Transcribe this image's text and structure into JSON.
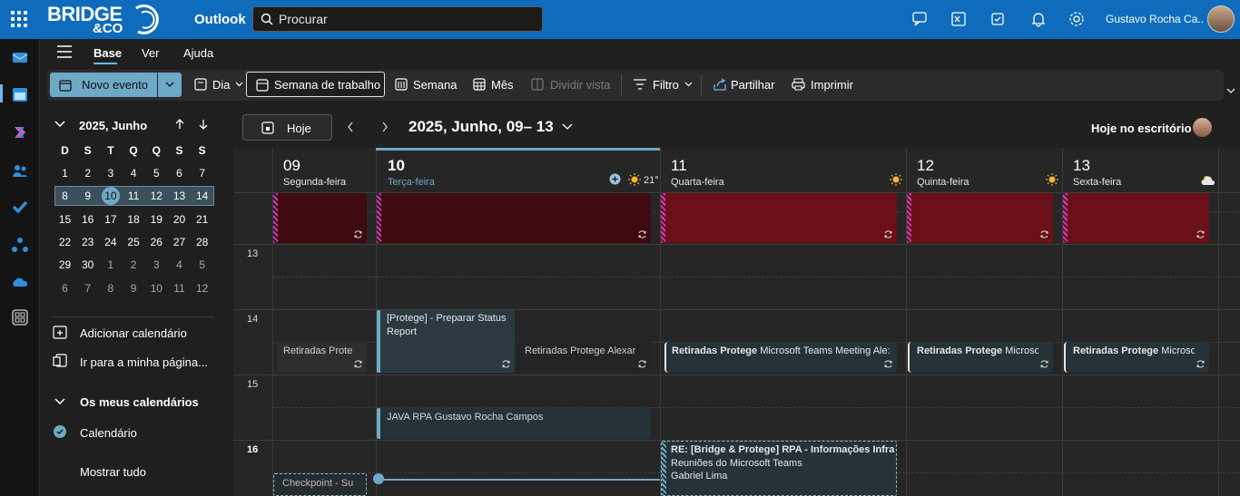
{
  "app": {
    "brand_line1": "BRIDGE",
    "brand_line2": "&CO",
    "name": "Outlook"
  },
  "search": {
    "placeholder": "Procurar"
  },
  "user": {
    "name": "Gustavo Rocha Ca..."
  },
  "tabs": [
    {
      "label": "Base"
    },
    {
      "label": "Ver"
    },
    {
      "label": "Ajuda"
    }
  ],
  "ribbon": {
    "novo_evento": "Novo evento",
    "dia": "Dia",
    "semana_trabalho": "Semana de trabalho",
    "semana": "Semana",
    "mes": "Mês",
    "dividir": "Dividir vista",
    "filtro": "Filtro",
    "partilhar": "Partilhar",
    "imprimir": "Imprimir"
  },
  "minical": {
    "title": "2025, Junho",
    "weekdays": [
      "D",
      "S",
      "T",
      "Q",
      "Q",
      "S",
      "S"
    ],
    "weeks": [
      [
        "1",
        "2",
        "3",
        "4",
        "5",
        "6",
        "7"
      ],
      [
        "8",
        "9",
        "10",
        "11",
        "12",
        "13",
        "14"
      ],
      [
        "15",
        "16",
        "17",
        "18",
        "19",
        "20",
        "21"
      ],
      [
        "22",
        "23",
        "24",
        "25",
        "26",
        "27",
        "28"
      ],
      [
        "29",
        "30",
        "1",
        "2",
        "3",
        "4",
        "5"
      ],
      [
        "6",
        "7",
        "8",
        "9",
        "10",
        "11",
        "12"
      ]
    ]
  },
  "sidebar": {
    "add_calendar": "Adicionar calendário",
    "my_page": "Ir para a minha página...",
    "my_calendars": "Os meus calendários",
    "calendar": "Calendário",
    "show_all": "Mostrar tudo"
  },
  "calendar": {
    "today_btn": "Hoje",
    "range": "2025, Junho, 09– 13",
    "office": "Hoje no escritório",
    "temp": "21°",
    "days": [
      {
        "num": "09",
        "name": "Segunda-feira"
      },
      {
        "num": "10",
        "name": "Terça-feira"
      },
      {
        "num": "11",
        "name": "Quarta-feira"
      },
      {
        "num": "12",
        "name": "Quinta-feira"
      },
      {
        "num": "13",
        "name": "Sexta-feira"
      }
    ],
    "hours": [
      "13",
      "14",
      "15",
      "16"
    ],
    "events": {
      "e1": "Retiradas Prote",
      "e2a": "[Protege] - Preparar Status",
      "e2b": "Report",
      "e3": "Retiradas Protege Alexar",
      "e4b": "Retiradas Protege",
      "e4": " Microsoft Teams Meeting Ale:",
      "e5b": "Retiradas Protege",
      "e5": " Microsof",
      "e6b": "Retiradas Protege",
      "e6": " Microsof",
      "e7": "JAVA RPA Gustavo Rocha Campos",
      "e8a": "RE: [Bridge & Protege] RPA - Informações Infra",
      "e8b": "Reuniões do Microsoft Teams",
      "e8c": "Gabriel Lima",
      "e9": "Checkpoint - Su"
    }
  }
}
